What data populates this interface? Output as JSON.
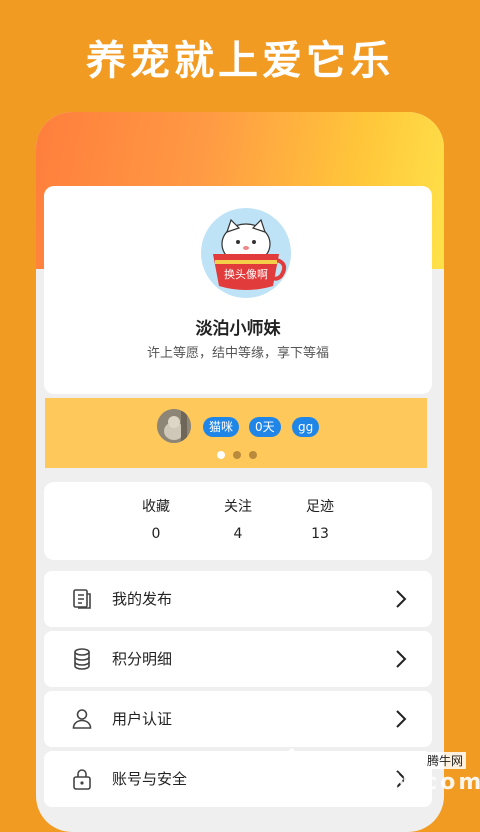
{
  "banner": {
    "title": "养宠就上爱它乐"
  },
  "profile": {
    "avatar_caption": "换头像啊",
    "name": "淡泊小师妹",
    "motto": "许上等愿，结中等缘，享下等福"
  },
  "pet": {
    "tags": [
      "猫咪",
      "0天",
      "gg"
    ],
    "pager_active": 0,
    "pager_count": 3
  },
  "stats": [
    {
      "label": "收藏",
      "value": "0"
    },
    {
      "label": "关注",
      "value": "4"
    },
    {
      "label": "足迹",
      "value": "13"
    }
  ],
  "menu": [
    {
      "label": "我的发布",
      "icon": "document-icon"
    },
    {
      "label": "积分明细",
      "icon": "coins-icon"
    },
    {
      "label": "用户认证",
      "icon": "user-icon"
    },
    {
      "label": "账号与安全",
      "icon": "lock-icon"
    }
  ],
  "watermark": {
    "text_cn": "腾牛网",
    "text_en": "QQTN.com"
  },
  "colors": {
    "background": "#f29b22",
    "tag": "#1f86e8",
    "strip": "#ffc85a"
  }
}
